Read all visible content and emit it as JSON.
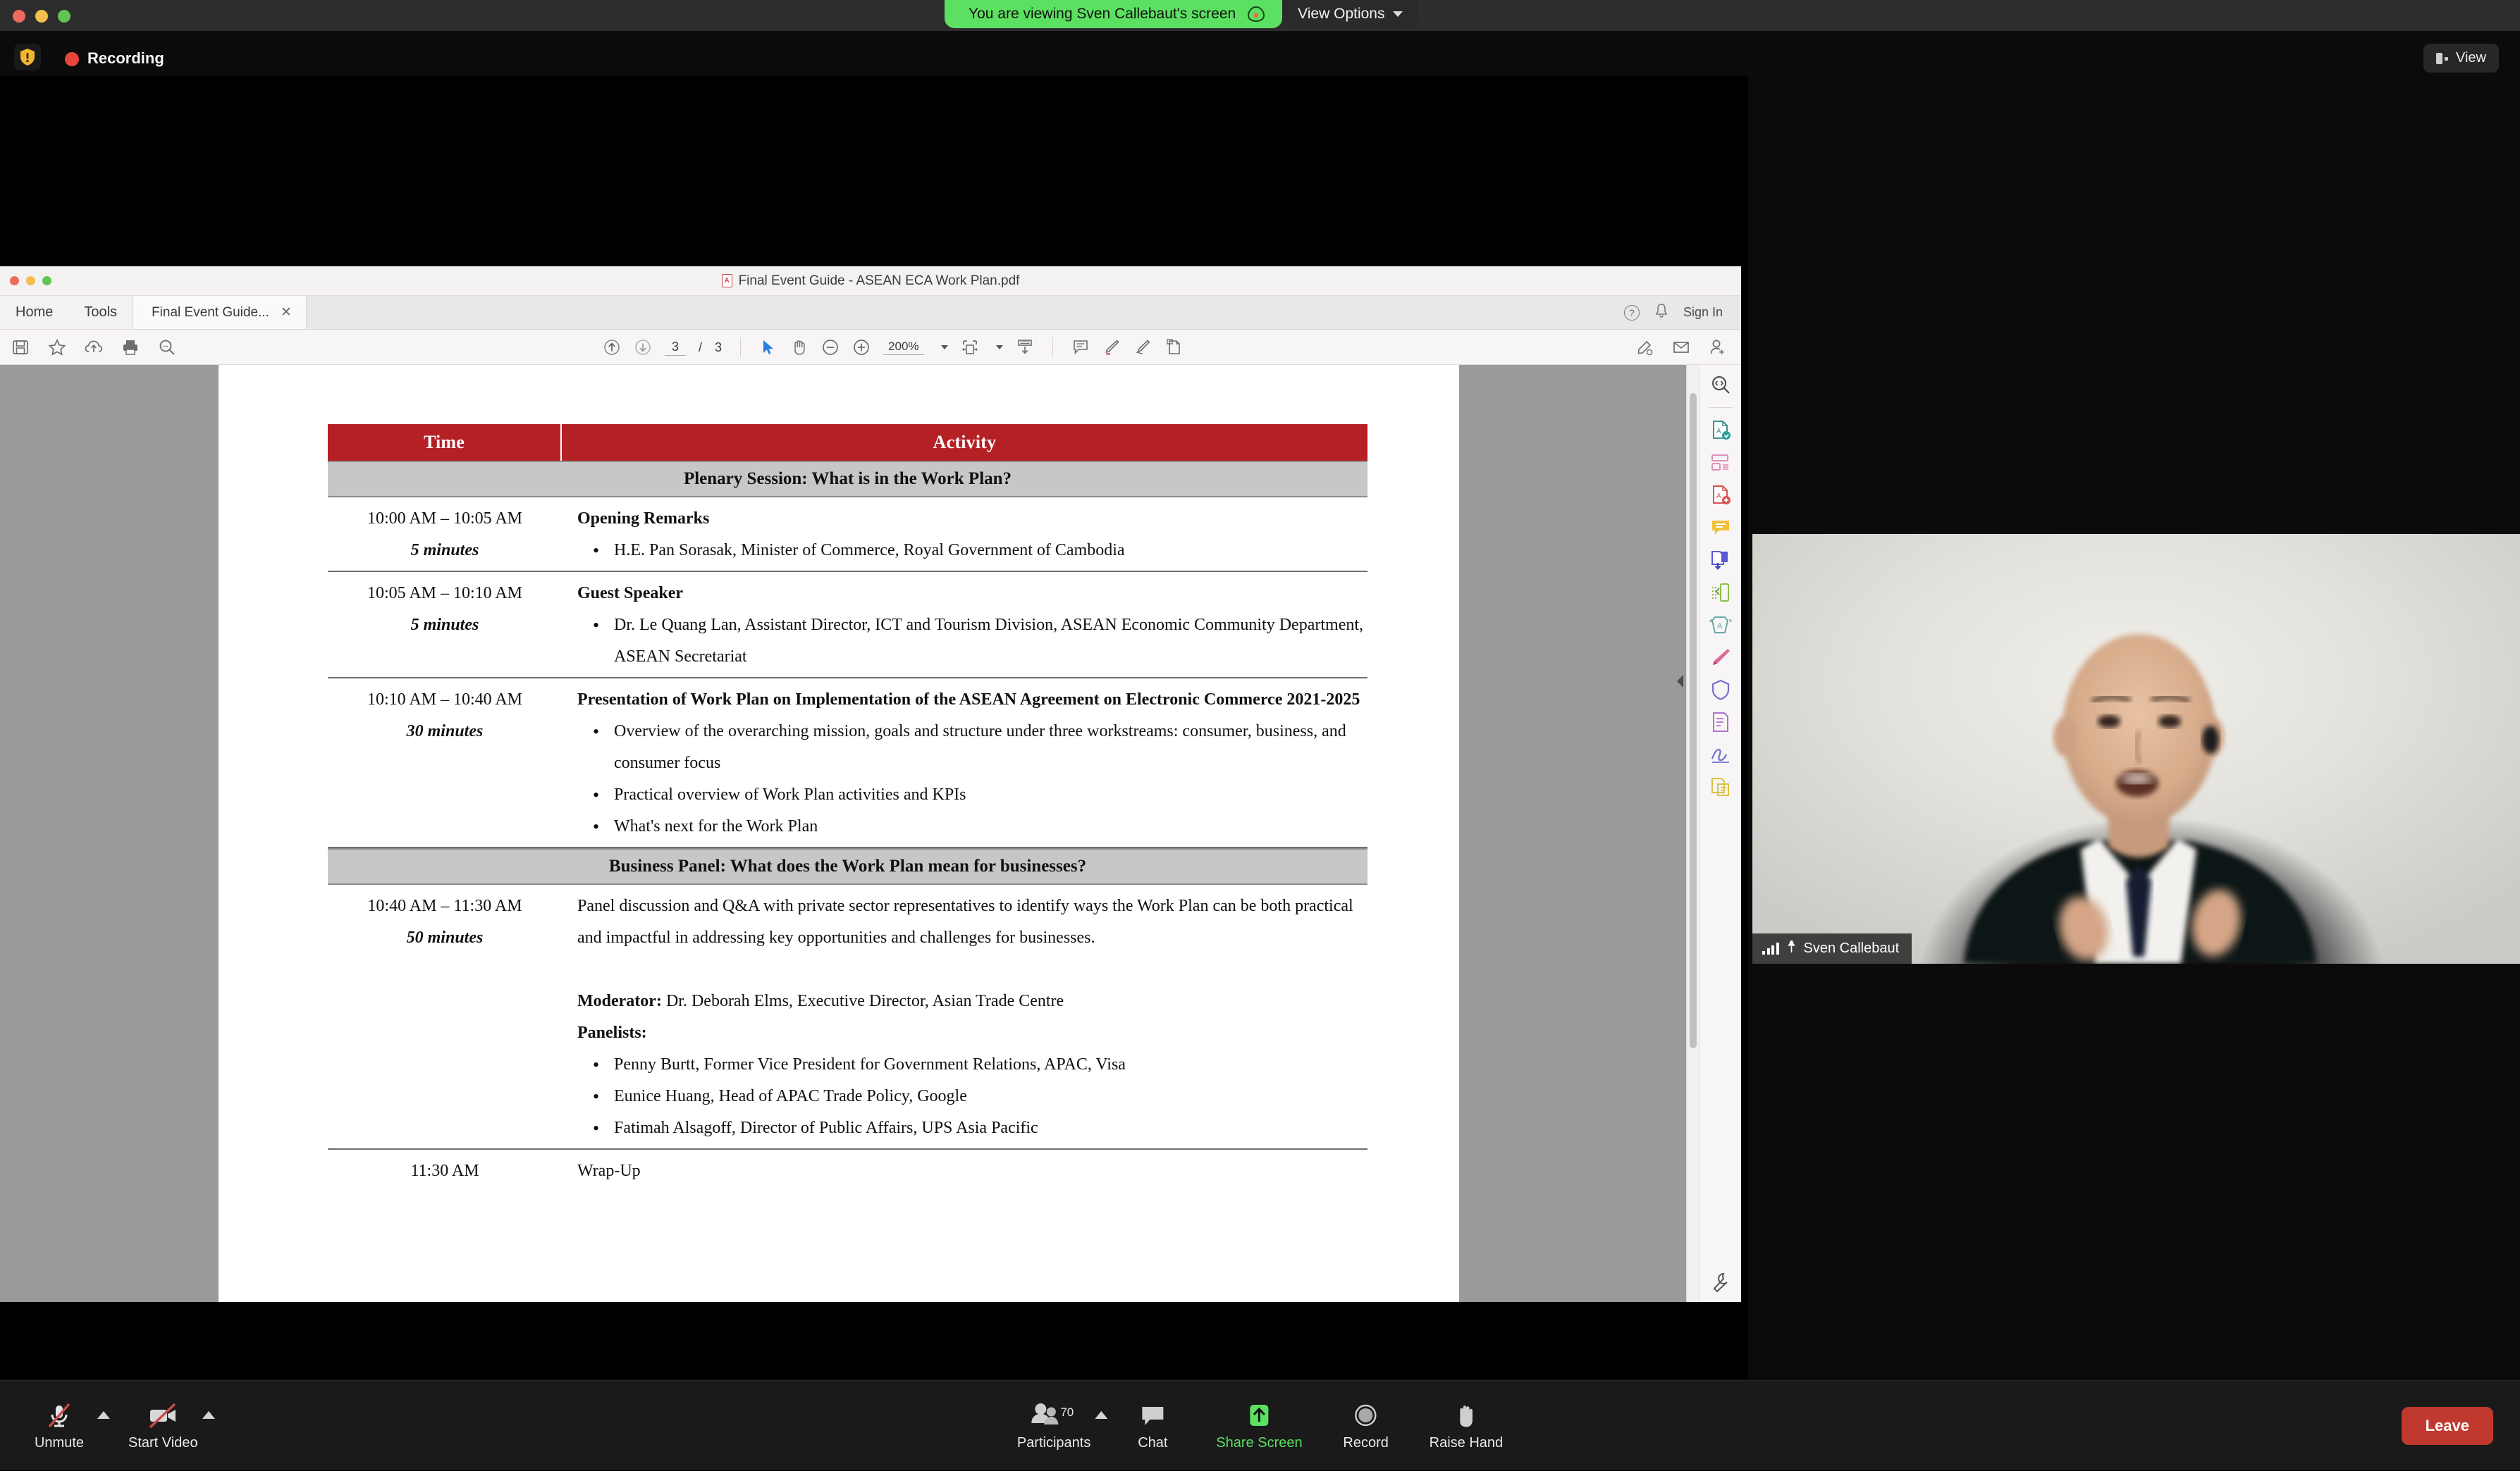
{
  "zoom_meeting": {
    "viewing_banner": {
      "text": "You are viewing Sven Callebaut's screen",
      "share_icon": "screen-share-cloud-icon",
      "view_options_label": "View Options",
      "chevron_icon": "chevron-down-icon"
    },
    "recording": {
      "shield_icon": "security-shield-icon",
      "label": "Recording",
      "dot_icon": "recording-dot-icon"
    },
    "view_button": {
      "label": "View",
      "icon": "layout-view-icon"
    },
    "video_tile": {
      "participant_name": "Sven Callebaut",
      "signal_icon": "signal-strength-icon",
      "pin_icon": "pinned-icon"
    },
    "toolbar": {
      "audio": {
        "label": "Unmute",
        "icon": "microphone-muted-icon",
        "has_menu": true
      },
      "video": {
        "label": "Start Video",
        "icon": "camera-off-icon",
        "has_menu": true
      },
      "participants": {
        "label": "Participants",
        "icon": "participants-icon",
        "count": "70",
        "has_menu": true
      },
      "chat": {
        "label": "Chat",
        "icon": "chat-bubble-icon"
      },
      "share_screen": {
        "label": "Share Screen",
        "icon": "share-screen-arrow-icon",
        "accent": "#5ce061"
      },
      "record": {
        "label": "Record",
        "icon": "record-circle-icon"
      },
      "raise_hand": {
        "label": "Raise Hand",
        "icon": "raised-hand-icon"
      },
      "leave": {
        "label": "Leave",
        "accent": "#c0392f"
      }
    }
  },
  "acrobat": {
    "window_title": "Final Event Guide - ASEAN ECA Work Plan.pdf",
    "title_icon": "pdf-file-icon",
    "menu": {
      "home": "Home",
      "tools": "Tools"
    },
    "document_tab": {
      "label": "Final Event Guide...",
      "close_icon": "close-icon"
    },
    "account_bar": {
      "help_icon": "help-circle-icon",
      "bell_icon": "notification-bell-icon",
      "sign_in": "Sign In"
    },
    "toolbar_left_icons": [
      "save-icon",
      "star-icon",
      "upload-cloud-icon",
      "print-icon",
      "search-icon"
    ],
    "toolbar_center": {
      "previous_page_icon": "arrow-up-circle-icon",
      "next_page_icon": "arrow-down-circle-icon",
      "page_number": "3",
      "page_separator": "/",
      "page_total": "3",
      "select_tool_icon": "cursor-select-icon",
      "hand_tool_icon": "hand-tool-icon",
      "zoom_out_icon": "zoom-out-icon",
      "zoom_in_icon": "zoom-in-icon",
      "zoom_level": "200%",
      "zoom_dropdown_icon": "chevron-down-icon",
      "fit_page_icon": "fit-page-icon",
      "fit_dropdown_icon": "chevron-down-icon",
      "read_mode_icon": "read-mode-icon",
      "comment_icon": "comment-icon",
      "highlight_icon": "highlight-pen-icon",
      "draw_icon": "draw-freehand-icon",
      "stamp_icon": "stamp-icon"
    },
    "toolbar_right_icons": [
      "share-link-icon",
      "email-icon",
      "add-user-icon"
    ]
  },
  "tools_rail": {
    "icons": [
      "search-document-icon",
      "export-pdf-icon",
      "organize-pages-icon",
      "create-pdf-icon",
      "comment-tool-icon",
      "combine-files-icon",
      "compress-pdf-icon",
      "redact-pdf-icon",
      "edit-pdf-icon",
      "protect-icon",
      "fill-and-sign-icon",
      "request-signature-icon",
      "scan-and-ocr-icon",
      "more-tools-icon"
    ]
  },
  "document": {
    "columns": [
      "Time",
      "Activity"
    ],
    "sections": [
      {
        "band": "Plenary Session: What is in the Work Plan?",
        "rows": [
          {
            "time": "10:00 AM – 10:05 AM",
            "duration": "5 minutes",
            "heading": "Opening Remarks",
            "bullets": [
              "H.E. Pan Sorasak, Minister of Commerce, Royal Government of Cambodia"
            ]
          },
          {
            "time": "10:05 AM – 10:10 AM",
            "duration": "5 minutes",
            "heading": "Guest Speaker",
            "bullets": [
              "Dr. Le Quang Lan, Assistant Director, ICT and Tourism Division, ASEAN Economic Community Department, ASEAN Secretariat"
            ]
          },
          {
            "time": "10:10 AM – 10:40 AM",
            "duration": "30 minutes",
            "heading": "Presentation of Work Plan on Implementation of the ASEAN Agreement on Electronic Commerce 2021-2025",
            "bullets": [
              "Overview of the overarching mission, goals and structure under three workstreams: consumer, business, and consumer focus",
              "Practical overview of Work Plan activities and KPIs",
              "What's next for the Work Plan"
            ]
          }
        ]
      },
      {
        "band": "Business Panel: What does the Work Plan mean for businesses?",
        "rows": [
          {
            "time": "10:40 AM – 11:30 AM",
            "duration": "50 minutes",
            "paragraph": "Panel discussion and Q&A with private sector representatives to identify ways the Work Plan can be both practical and impactful in addressing key opportunities and challenges for businesses.",
            "moderator_label": "Moderator:",
            "moderator_text": " Dr. Deborah Elms, Executive Director, Asian Trade Centre",
            "panelists_label": "Panelists:",
            "bullets": [
              "Penny Burtt, Former Vice President for Government Relations, APAC, Visa",
              "Eunice Huang, Head of APAC Trade Policy, Google",
              "Fatimah Alsagoff, Director of Public Affairs, UPS Asia Pacific"
            ]
          },
          {
            "time": "11:30 AM",
            "duration": "",
            "plain": "Wrap-Up"
          }
        ]
      }
    ]
  }
}
